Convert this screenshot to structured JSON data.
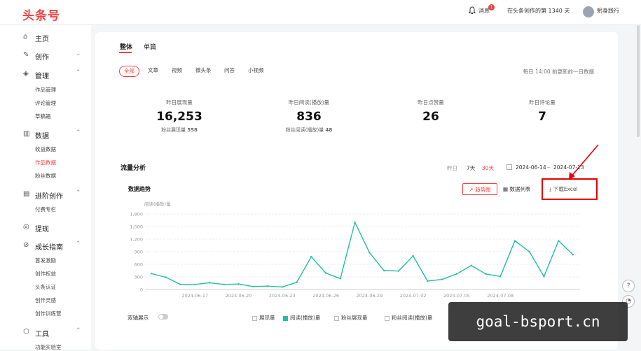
{
  "header": {
    "logo": "头条号",
    "messages_label": "消息",
    "messages_badge": "1",
    "days_text": "在头条创作的第 1340 天",
    "username": "躬身践行"
  },
  "sidebar": {
    "home": "主页",
    "create": "创作",
    "manage": "管理",
    "manage_items": [
      "作品管理",
      "评论管理",
      "草稿箱"
    ],
    "data": "数据",
    "data_items": [
      "收益数据",
      "作品数据",
      "粉丝数据"
    ],
    "advanced": "进阶创作",
    "advanced_items": [
      "付费专栏"
    ],
    "withdraw": "提现",
    "growth": "成长指南",
    "growth_items": [
      "首发激励",
      "创作权益",
      "头条认证",
      "创作灵感",
      "创作训练营"
    ],
    "tools": "工具",
    "tools_items": [
      "功能实验室"
    ]
  },
  "main": {
    "tabs": [
      "整体",
      "单篇"
    ],
    "pills": [
      "全部",
      "文章",
      "视频",
      "微头条",
      "问答",
      "小视频"
    ],
    "update_note": "每日 14:00 前更新前一日数据",
    "metrics": [
      {
        "label": "昨日展现量",
        "value": "16,253",
        "sub_label": "粉丝展现量",
        "sub_value": "558"
      },
      {
        "label": "昨日阅读(播放)量",
        "value": "836",
        "sub_label": "粉丝阅读(播放)量",
        "sub_value": "48"
      },
      {
        "label": "昨日点赞量",
        "value": "26",
        "sub_label": "",
        "sub_value": ""
      },
      {
        "label": "昨日评论量",
        "value": "7",
        "sub_label": "",
        "sub_value": ""
      }
    ],
    "traffic_title": "流量分析",
    "range_options": [
      "昨日",
      "7天",
      "30天"
    ],
    "date_start": "2024-06-14",
    "date_sep": "~",
    "date_end": "2024-07-13",
    "chart_section_title": "数据趋势",
    "trend_btn": "趋势图",
    "list_btn": "数据列表",
    "excel_btn": "下载Excel",
    "dual_axis_label": "双轴展示",
    "legend": [
      "展现量",
      "阅读(播放)量",
      "粉丝展现量",
      "粉丝阅读(播放)量"
    ]
  },
  "watermark": "goal-bsport.cn",
  "colors": {
    "accent": "#f04142",
    "series": "#20c0a0",
    "highlight_box": "#e60000"
  },
  "chart_data": {
    "type": "line",
    "ylabel": "阅读(播放)量",
    "ylim": [
      0,
      1800
    ],
    "yticks": [
      0,
      300,
      600,
      900,
      1200,
      1500,
      1800
    ],
    "tick_labels": [
      "2024-06-17",
      "2024-06-20",
      "2024-06-23",
      "2024-06-26",
      "2024-06-29",
      "2024-07-02",
      "2024-07-05",
      "2024-07-08"
    ],
    "x": [
      "2024-06-14",
      "2024-06-15",
      "2024-06-16",
      "2024-06-17",
      "2024-06-18",
      "2024-06-19",
      "2024-06-20",
      "2024-06-21",
      "2024-06-22",
      "2024-06-23",
      "2024-06-24",
      "2024-06-25",
      "2024-06-26",
      "2024-06-27",
      "2024-06-28",
      "2024-06-29",
      "2024-06-30",
      "2024-07-01",
      "2024-07-02",
      "2024-07-03",
      "2024-07-04",
      "2024-07-05",
      "2024-07-06",
      "2024-07-07",
      "2024-07-08",
      "2024-07-09",
      "2024-07-10",
      "2024-07-11",
      "2024-07-12",
      "2024-07-13"
    ],
    "series": [
      {
        "name": "阅读(播放)量",
        "values": [
          380,
          290,
          120,
          120,
          160,
          120,
          130,
          70,
          80,
          60,
          170,
          780,
          390,
          260,
          1600,
          880,
          450,
          440,
          800,
          200,
          240,
          370,
          570,
          370,
          310,
          1160,
          900,
          310,
          1160,
          830
        ]
      }
    ],
    "grid": true
  }
}
